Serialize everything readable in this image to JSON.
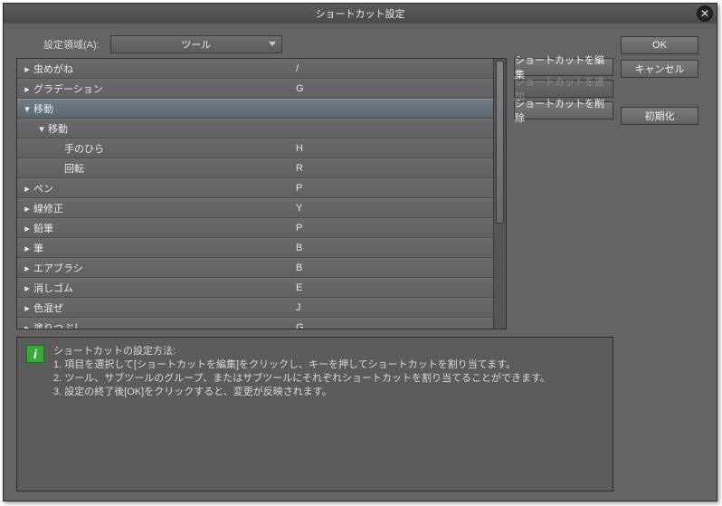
{
  "dialog": {
    "title": "ショートカット設定"
  },
  "settings_area": {
    "label": "設定領域(A):",
    "value": "ツール"
  },
  "tree": {
    "rows": [
      {
        "label": "虫めがね",
        "shortcut": "/",
        "depth": 0,
        "expanded": false,
        "selected": false
      },
      {
        "label": "グラデーション",
        "shortcut": "G",
        "depth": 0,
        "expanded": false,
        "selected": false
      },
      {
        "label": "移動",
        "shortcut": "",
        "depth": 0,
        "expanded": true,
        "selected": true
      },
      {
        "label": "移動",
        "shortcut": "",
        "depth": 1,
        "expanded": true,
        "selected": false
      },
      {
        "label": "手のひら",
        "shortcut": "H",
        "depth": 2,
        "expanded": null,
        "selected": false
      },
      {
        "label": "回転",
        "shortcut": "R",
        "depth": 2,
        "expanded": null,
        "selected": false
      },
      {
        "label": "ペン",
        "shortcut": "P",
        "depth": 0,
        "expanded": false,
        "selected": false
      },
      {
        "label": "線修正",
        "shortcut": "Y",
        "depth": 0,
        "expanded": false,
        "selected": false
      },
      {
        "label": "鉛筆",
        "shortcut": "P",
        "depth": 0,
        "expanded": false,
        "selected": false
      },
      {
        "label": "筆",
        "shortcut": "B",
        "depth": 0,
        "expanded": false,
        "selected": false
      },
      {
        "label": "エアブラシ",
        "shortcut": "B",
        "depth": 0,
        "expanded": false,
        "selected": false
      },
      {
        "label": "消しゴム",
        "shortcut": "E",
        "depth": 0,
        "expanded": false,
        "selected": false
      },
      {
        "label": "色混ぜ",
        "shortcut": "J",
        "depth": 0,
        "expanded": false,
        "selected": false
      },
      {
        "label": "塗りつぶし",
        "shortcut": "G",
        "depth": 0,
        "expanded": false,
        "selected": false
      }
    ]
  },
  "side_buttons": {
    "edit": "ショートカットを編集",
    "add": "ショートカットを追加",
    "delete": "ショートカットを削除"
  },
  "right_buttons": {
    "ok": "OK",
    "cancel": "キャンセル",
    "init": "初期化"
  },
  "info": {
    "heading": "ショートカットの設定方法:",
    "line1": "1. 項目を選択して[ショートカットを編集]をクリックし、キーを押してショートカットを割り当てます。",
    "line2": "2. ツール、サブツールのグループ、またはサブツールにそれぞれショートカットを割り当てることができます。",
    "line3": "3. 設定の終了後[OK]をクリックすると、変更が反映されます。"
  }
}
